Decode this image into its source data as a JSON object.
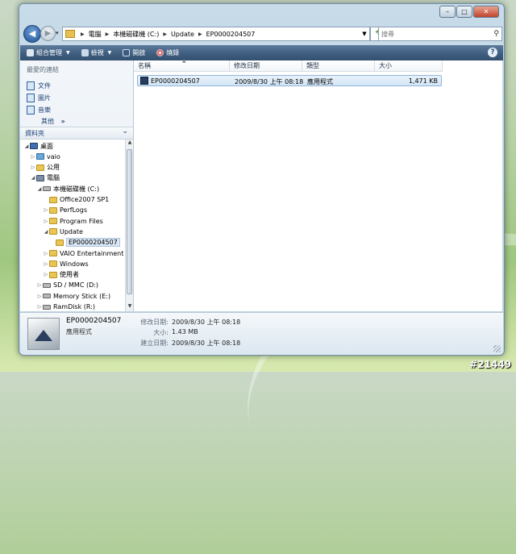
{
  "address": {
    "crumbs": [
      "電腦",
      "本機磁碟機 (C:)",
      "Update",
      "EP0000204507"
    ],
    "search_placeholder": "搜尋"
  },
  "toolbar": {
    "organize": "組合管理",
    "views": "檢視",
    "open": "開啟",
    "burn": "燒錄",
    "help": "?"
  },
  "favorites": {
    "title": "最愛的連結",
    "items": [
      "文件",
      "圖片",
      "音樂"
    ],
    "more": "其他",
    "more_chevron": "»"
  },
  "folders": {
    "title": "資料夾",
    "tree": [
      {
        "label": "桌面",
        "icon": "desktop-icon",
        "level": 0,
        "expanded": true
      },
      {
        "label": "vaio",
        "icon": "user-folder-icon",
        "level": 1,
        "expanded": false
      },
      {
        "label": "公用",
        "icon": "folder-icon",
        "level": 1,
        "expanded": false
      },
      {
        "label": "電腦",
        "icon": "computer-icon",
        "level": 1,
        "expanded": true
      },
      {
        "label": "本機磁碟機 (C:)",
        "icon": "drive-icon",
        "level": 2,
        "expanded": true
      },
      {
        "label": "Office2007 SP1",
        "icon": "folder-icon",
        "level": 3,
        "expanded": null
      },
      {
        "label": "PerfLogs",
        "icon": "folder-icon",
        "level": 3,
        "expanded": false
      },
      {
        "label": "Program Files",
        "icon": "folder-icon",
        "level": 3,
        "expanded": false
      },
      {
        "label": "Update",
        "icon": "folder-icon",
        "level": 3,
        "expanded": true
      },
      {
        "label": "EP0000204507",
        "icon": "folder-icon",
        "level": 4,
        "expanded": null,
        "selected": true
      },
      {
        "label": "VAIO Entertainment",
        "icon": "folder-icon",
        "level": 3,
        "expanded": false
      },
      {
        "label": "Windows",
        "icon": "folder-icon",
        "level": 3,
        "expanded": false
      },
      {
        "label": "使用者",
        "icon": "folder-icon",
        "level": 3,
        "expanded": false
      },
      {
        "label": "SD / MMC (D:)",
        "icon": "drive-icon",
        "level": 2,
        "expanded": false
      },
      {
        "label": "Memory Stick (E:)",
        "icon": "drive-icon",
        "level": 2,
        "expanded": false
      },
      {
        "label": "RamDisk (R:)",
        "icon": "drive-icon",
        "level": 2,
        "expanded": false
      }
    ]
  },
  "columns": [
    "名稱",
    "修改日期",
    "類型",
    "大小"
  ],
  "files": [
    {
      "name": "EP0000204507",
      "modified": "2009/8/30 上午 08:18",
      "type": "應用程式",
      "size": "1,471 KB"
    }
  ],
  "details": {
    "name": "EP0000204507",
    "type": "應用程式",
    "fields": [
      {
        "label": "修改日期:",
        "value": "2009/8/30 上午 08:18"
      },
      {
        "label": "大小:",
        "value": "1.43 MB"
      },
      {
        "label": "建立日期:",
        "value": "2009/8/30 上午 08:18"
      }
    ]
  },
  "watermark": "#21449"
}
